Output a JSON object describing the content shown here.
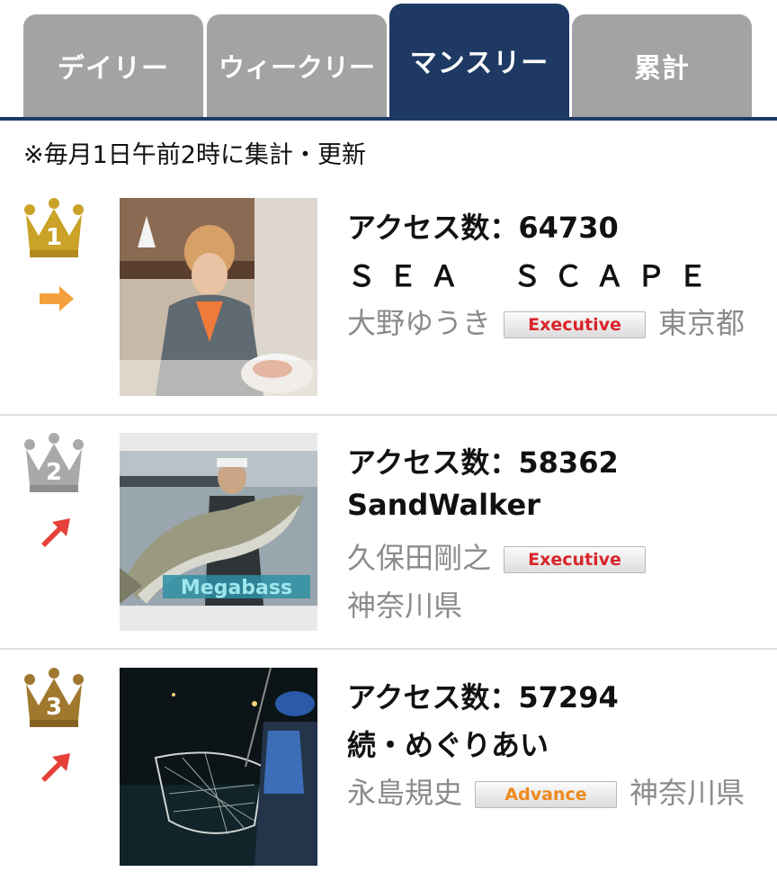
{
  "tabs": [
    {
      "label": "デイリー",
      "active": false
    },
    {
      "label": "ウィークリー",
      "active": false
    },
    {
      "label": "マンスリー",
      "active": true
    },
    {
      "label": "累計",
      "active": false
    }
  ],
  "note": "※毎月1日午前2時に集計・更新",
  "photo_overlay_text": "Megabass",
  "ranking": [
    {
      "rank": "1",
      "crown_color": "gold",
      "trend": "same",
      "access_label": "アクセス数：64730",
      "blog_title": "ＳＥＡ　ＳＣＡＰＥ",
      "author": "大野ゆうき",
      "badge": "Executive",
      "prefecture": "東京都"
    },
    {
      "rank": "2",
      "crown_color": "silver",
      "trend": "up",
      "access_label": "アクセス数：58362",
      "blog_title": "SandWalker",
      "author": "久保田剛之",
      "badge": "Executive",
      "prefecture": "神奈川県"
    },
    {
      "rank": "3",
      "crown_color": "bronze",
      "trend": "up",
      "access_label": "アクセス数：57294",
      "blog_title": "続・めぐりあい",
      "author": "永島規史",
      "badge": "Advance",
      "prefecture": "神奈川県"
    }
  ],
  "colors": {
    "tab_active": "#1e3a64",
    "tab_inactive": "#a3a3a3",
    "badge_executive": "#d9252b",
    "badge_advance": "#ef8a1c",
    "crown_gold": "#c9a227",
    "crown_silver": "#a9a9a9",
    "crown_bronze": "#a0782e"
  }
}
